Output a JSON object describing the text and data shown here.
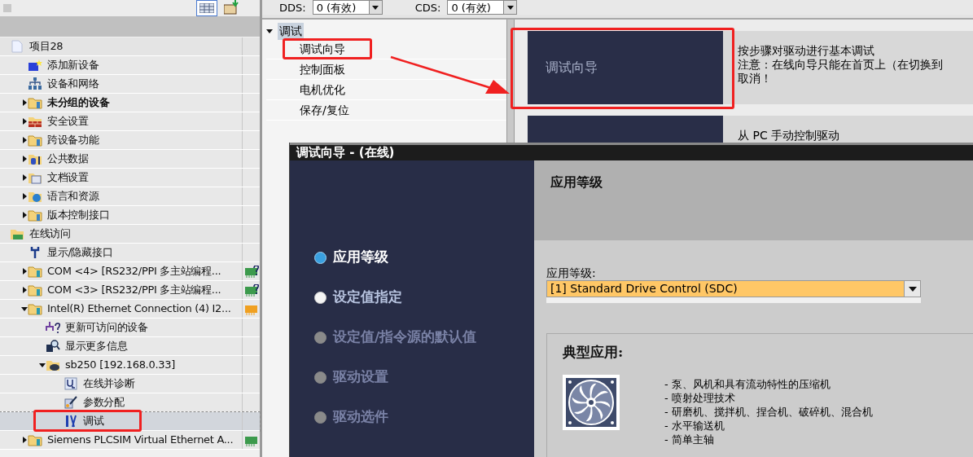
{
  "project_tree": [
    {
      "label": "项目28",
      "bold": false,
      "selected": false,
      "children": [
        {
          "label": "添加新设备",
          "bold": false,
          "selected": false
        },
        {
          "label": "设备和网络",
          "bold": false,
          "selected": false
        },
        {
          "label": "未分组的设备",
          "bold": true,
          "selected": false,
          "expanded": false
        },
        {
          "label": "安全设置",
          "bold": false,
          "selected": false,
          "expanded": false
        },
        {
          "label": "跨设备功能",
          "bold": false,
          "selected": false,
          "expanded": false
        },
        {
          "label": "公共数据",
          "bold": false,
          "selected": false,
          "expanded": false
        },
        {
          "label": "文档设置",
          "bold": false,
          "selected": false,
          "expanded": false
        },
        {
          "label": "语言和资源",
          "bold": false,
          "selected": false,
          "expanded": false
        },
        {
          "label": "版本控制接口",
          "bold": false,
          "selected": false,
          "expanded": false
        }
      ]
    },
    {
      "label": "在线访问",
      "bold": false,
      "selected": false,
      "children": [
        {
          "label": "显示/隐藏接口",
          "bold": false,
          "selected": false
        },
        {
          "label": "COM <4> [RS232/PPI 多主站编程...",
          "bold": false,
          "selected": false,
          "expanded": false,
          "status": {
            "color": "#3c9a4c",
            "unknown": true
          }
        },
        {
          "label": "COM <3> [RS232/PPI 多主站编程...",
          "bold": false,
          "selected": false,
          "expanded": false,
          "status": {
            "color": "#3c9a4c",
            "unknown": true
          }
        },
        {
          "label": "Intel(R) Ethernet Connection (4) I2...",
          "bold": false,
          "selected": false,
          "expanded": true,
          "status": {
            "color": "#f0a020",
            "unknown": false
          },
          "children": [
            {
              "label": "更新可访问的设备",
              "bold": false,
              "selected": false
            },
            {
              "label": "显示更多信息",
              "bold": false,
              "selected": false
            },
            {
              "label": "sb250 [192.168.0.33]",
              "bold": false,
              "selected": false,
              "expanded": true,
              "children": [
                {
                  "label": "在线并诊断",
                  "bold": false,
                  "selected": false
                },
                {
                  "label": "参数分配",
                  "bold": false,
                  "selected": false
                },
                {
                  "label": "调试",
                  "bold": false,
                  "selected": true
                }
              ]
            }
          ]
        },
        {
          "label": "Siemens PLCSIM Virtual Ethernet A...",
          "bold": false,
          "selected": false,
          "expanded": false,
          "status": {
            "color": "#3c9a4c",
            "unknown": false
          }
        }
      ]
    }
  ],
  "top_bar": [
    {
      "label": "DDS:",
      "value": "0 (有效)"
    },
    {
      "label": "CDS:",
      "value": "0 (有效)"
    }
  ],
  "function_tree": {
    "label": "调试",
    "expanded": true,
    "children": [
      {
        "label": "调试向导",
        "selected": false
      },
      {
        "label": "控制面板",
        "selected": false
      },
      {
        "label": "电机优化",
        "selected": false
      },
      {
        "label": "保存/复位",
        "selected": false
      }
    ]
  },
  "cards": [
    {
      "title": "调试向导",
      "description": [
        "按步骤对驱动进行基本调试",
        "注意：在线向导只能在首页上（在切换到",
        "取消！"
      ]
    },
    {
      "description": [
        "从 PC 手动控制驱动"
      ]
    }
  ],
  "wizard": {
    "title": "调试向导 - (在线)",
    "steps": [
      {
        "label": "应用等级",
        "selected": true,
        "disabled": false
      },
      {
        "label": "设定值指定",
        "selected": false,
        "disabled": false
      },
      {
        "label": "设定值/指令源的默认值",
        "selected": false,
        "disabled": true
      },
      {
        "label": "驱动设置",
        "selected": false,
        "disabled": true
      },
      {
        "label": "驱动选件",
        "selected": false,
        "disabled": true
      }
    ],
    "heading": "应用等级",
    "field_label": "应用等级:",
    "field_value": "[1] Standard Drive Control (SDC)",
    "group_title": "典型应用:",
    "applications": [
      "- 泵、风机和具有流动特性的压缩机",
      "- 喷射处理技术",
      "- 研磨机、搅拌机、捏合机、破碎机、混合机",
      "- 水平输送机",
      "- 简单主轴"
    ]
  }
}
